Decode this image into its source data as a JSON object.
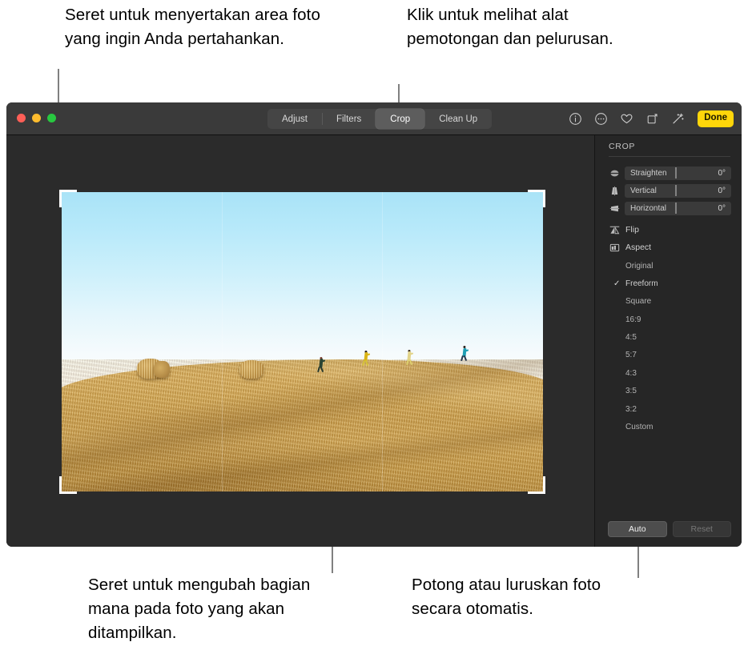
{
  "callouts": {
    "top_left": "Seret untuk menyertakan area foto yang ingin Anda pertahankan.",
    "top_right": "Klik untuk melihat alat pemotongan dan pelurusan.",
    "bottom_left": "Seret untuk mengubah bagian mana pada foto yang akan ditampilkan.",
    "bottom_right": "Potong atau luruskan foto secara otomatis."
  },
  "window": {
    "traffic_lights": [
      {
        "name": "close",
        "color": "#ff5f57"
      },
      {
        "name": "minimize",
        "color": "#febc2e"
      },
      {
        "name": "zoom",
        "color": "#28c840"
      }
    ],
    "tabs": [
      {
        "label": "Adjust",
        "active": false
      },
      {
        "label": "Filters",
        "active": false
      },
      {
        "label": "Crop",
        "active": true
      },
      {
        "label": "Clean Up",
        "active": false
      }
    ],
    "toolbar_icons": [
      "info-icon",
      "more-options-icon",
      "heart-icon",
      "rotate-icon",
      "auto-enhance-wand-icon"
    ],
    "done_label": "Done"
  },
  "sidebar": {
    "header": "CROP",
    "sliders": [
      {
        "icon": "straighten-icon",
        "label": "Straighten",
        "value": "0°"
      },
      {
        "icon": "vertical-perspective-icon",
        "label": "Vertical",
        "value": "0°"
      },
      {
        "icon": "horizontal-perspective-icon",
        "label": "Horizontal",
        "value": "0°"
      }
    ],
    "tools": [
      {
        "icon": "flip-icon",
        "label": "Flip"
      },
      {
        "icon": "aspect-icon",
        "label": "Aspect"
      }
    ],
    "aspect_options": [
      {
        "label": "Original",
        "selected": false
      },
      {
        "label": "Freeform",
        "selected": true
      },
      {
        "label": "Square",
        "selected": false
      },
      {
        "label": "16:9",
        "selected": false
      },
      {
        "label": "4:5",
        "selected": false
      },
      {
        "label": "5:7",
        "selected": false
      },
      {
        "label": "4:3",
        "selected": false
      },
      {
        "label": "3:5",
        "selected": false
      },
      {
        "label": "3:2",
        "selected": false
      },
      {
        "label": "Custom",
        "selected": false
      }
    ],
    "check_glyph": "✓",
    "buttons": {
      "auto": "Auto",
      "reset": "Reset"
    }
  },
  "photo": {
    "description": "Four people running along the crest of a golden harvested wheat field with two round hay bales, under a pale blue sky",
    "runners": [
      {
        "name": "runner-1",
        "shirt": "#2b4433",
        "pants": "#27382c",
        "hair": "#7a3a2a"
      },
      {
        "name": "runner-2",
        "shirt": "#d9b416",
        "pants": "#d6c23a",
        "hair": "#2c2018"
      },
      {
        "name": "runner-3",
        "shirt": "#e2d48a",
        "pants": "#ded06e",
        "hair": "#3a2c1e"
      },
      {
        "name": "runner-4",
        "shirt": "#1e9fb5",
        "pants": "#27384d",
        "hair": "#2a1f18"
      }
    ],
    "colors": {
      "sky_top": "#a9e3f7",
      "sky_bottom": "#ffffff",
      "field": "#cfa453",
      "bale": "#c9a055"
    }
  },
  "theme": {
    "accent": "#ffd60a",
    "window_bg": "#1c1c1c",
    "titlebar_bg": "#3a3a3a",
    "sidebar_bg": "#262626",
    "canvas_bg": "#2b2b2b"
  }
}
